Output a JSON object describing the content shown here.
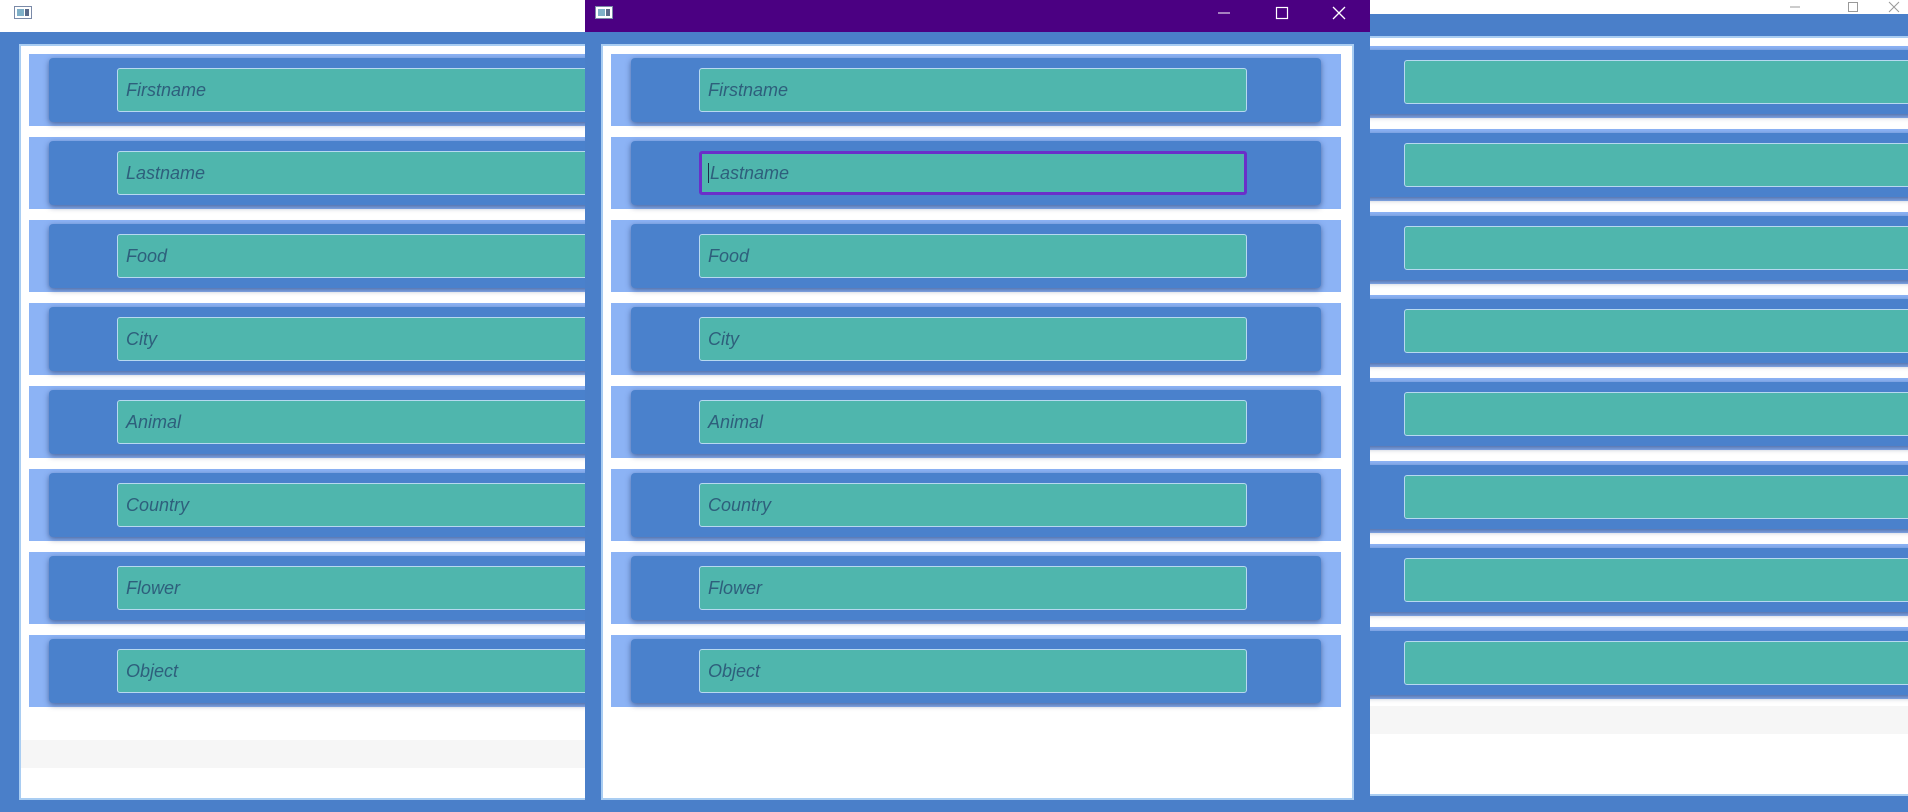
{
  "app": {
    "title": "",
    "fields": [
      {
        "placeholder": "Firstname"
      },
      {
        "placeholder": "Lastname"
      },
      {
        "placeholder": "Food"
      },
      {
        "placeholder": "City"
      },
      {
        "placeholder": "Animal"
      },
      {
        "placeholder": "Country"
      },
      {
        "placeholder": "Flower"
      },
      {
        "placeholder": "Object"
      }
    ],
    "focused_field": "Lastname"
  },
  "windows": [
    {
      "id": "left-window",
      "state": "inactive"
    },
    {
      "id": "center-window",
      "state": "active"
    },
    {
      "id": "right-window",
      "state": "inactive"
    }
  ],
  "icons": {
    "window_icon": "app-window-icon",
    "minimize": "minimize-icon",
    "maximize": "maximize-icon",
    "close": "close-icon"
  },
  "colors": {
    "active_titlebar": "#4b0082",
    "inactive_titlebar": "#ffffff",
    "window_frame": "#4a7fc9",
    "row_band": "#8cb3f5",
    "card": "#4a81cc",
    "textbox": "#4fb6ad",
    "textbox_border": "#b7d9f0",
    "focus_border": "#6a2fc9"
  }
}
